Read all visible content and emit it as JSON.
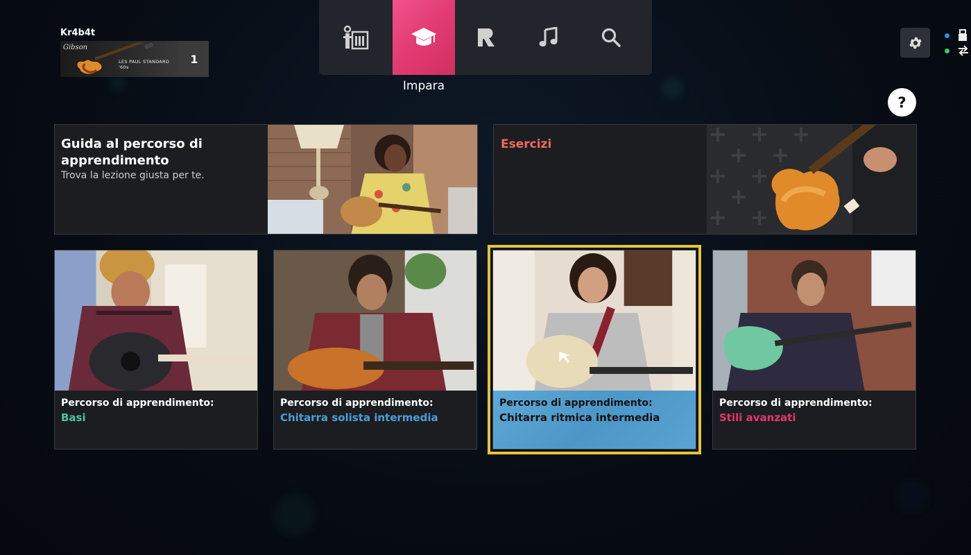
{
  "profile": {
    "username": "Kr4b4t",
    "gear_brand": "Gibson",
    "gear_model": "LES PAUL STANDARD '60s",
    "gear_level": "1"
  },
  "nav": {
    "items": [
      {
        "name": "career",
        "icon": "stage-amp-icon"
      },
      {
        "name": "learn",
        "icon": "graduation-cap-icon",
        "active": true
      },
      {
        "name": "rocksmith",
        "icon": "rocksmith-r-icon"
      },
      {
        "name": "songs",
        "icon": "music-note-icon"
      },
      {
        "name": "search",
        "icon": "search-icon"
      }
    ],
    "active_label": "Impara"
  },
  "help_label": "?",
  "guide_card": {
    "title": "Guida al percorso di apprendimento",
    "subtitle": "Trova la lezione giusta per te."
  },
  "exercises_card": {
    "title": "Esercizi",
    "title_color": "#f06a5a"
  },
  "paths": [
    {
      "line1": "Percorso di apprendimento:",
      "line2": "Basi",
      "color": "#4fc3a1"
    },
    {
      "line1": "Percorso di apprendimento:",
      "line2": "Chitarra solista intermedia",
      "color": "#4a9fd6"
    },
    {
      "line1": "Percorso di apprendimento:",
      "line2": "Chitarra ritmica intermedia",
      "color": "#111111",
      "selected": true
    },
    {
      "line1": "Percorso di apprendimento:",
      "line2": "Stili avanzati",
      "color": "#e8356a"
    }
  ],
  "colors": {
    "accent_pink": "#e23a73",
    "selection_yellow": "#e8c431",
    "status_blue": "#2a8ff0",
    "status_green": "#2ad46a"
  }
}
